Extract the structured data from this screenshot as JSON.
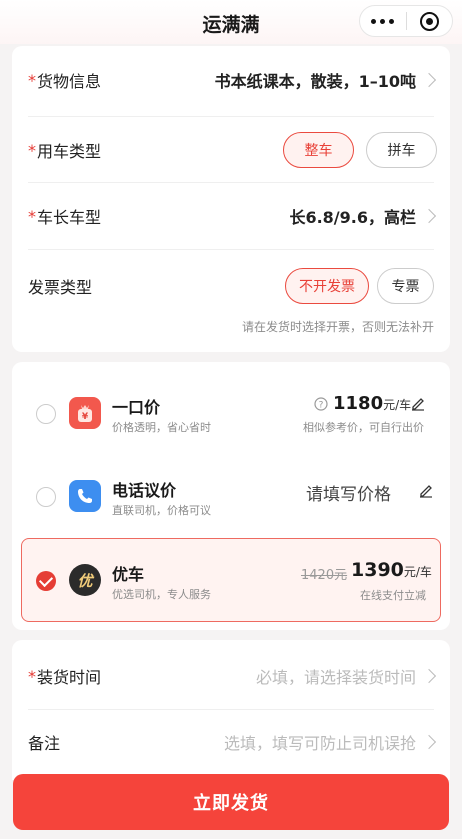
{
  "header": {
    "title": "运满满"
  },
  "cargo": {
    "required_mark": "*",
    "goods_label": "货物信息",
    "goods_value": "书本纸课本，散装，1–10吨",
    "vehicle_type_label": "用车类型",
    "vehicle_type_options": [
      "整车",
      "拼车"
    ],
    "vehicle_type_selected": "整车",
    "length_label": "车长车型",
    "length_value": "长6.8/9.6，高栏",
    "invoice_label": "发票类型",
    "invoice_options": [
      "不开发票",
      "专票"
    ],
    "invoice_selected": "不开发票",
    "invoice_hint": "请在发货时选择开票，否则无法补开"
  },
  "pricing": {
    "fixed": {
      "title": "一口价",
      "subtitle": "价格透明，省心省时",
      "price": "1180",
      "unit": "元/车",
      "note": "相似参考价，可自行出价",
      "icon": "yen-bag-icon"
    },
    "phone": {
      "title": "电话议价",
      "subtitle": "直联司机，价格可议",
      "placeholder": "请填写价格",
      "icon": "phone-icon"
    },
    "youche": {
      "title": "优车",
      "subtitle": "优选司机，专人服务",
      "original_price": "1420元",
      "price": "1390",
      "unit": "元/车",
      "note": "在线支付立减",
      "logo_text": "优",
      "selected": true
    }
  },
  "schedule": {
    "load_time_label": "装货时间",
    "load_time_placeholder": "必填，请选择装货时间",
    "remark_label": "备注",
    "remark_placeholder": "选填，填写可防止司机误抢"
  },
  "submit_label": "立即发货",
  "colors": {
    "accent": "#f5443b",
    "accent_light": "#fff2f0",
    "phone_blue": "#3d8ef0"
  }
}
